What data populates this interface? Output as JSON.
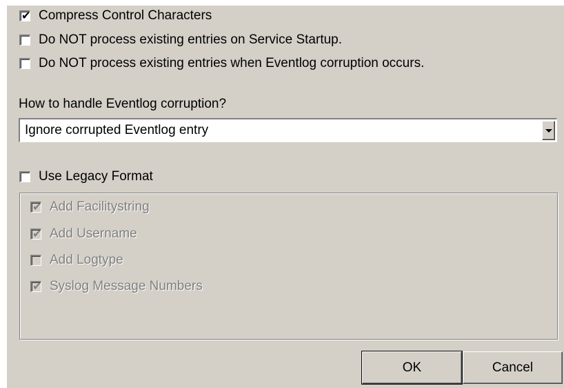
{
  "options": {
    "compress": {
      "label": "Compress Control Characters",
      "checked": true
    },
    "no_startup": {
      "label": "Do NOT process existing entries on Service Startup.",
      "checked": false
    },
    "no_corruption": {
      "label": "Do NOT process existing entries when Eventlog corruption occurs.",
      "checked": false
    }
  },
  "corruption": {
    "label": "How to handle Eventlog corruption?",
    "selected": "Ignore corrupted Eventlog entry"
  },
  "legacy": {
    "label": "Use Legacy Format",
    "checked": false
  },
  "legacy_options": {
    "facility": {
      "label": "Add Facilitystring",
      "checked": true
    },
    "username": {
      "label": "Add Username",
      "checked": true
    },
    "logtype": {
      "label": "Add Logtype",
      "checked": false
    },
    "msgnumbers": {
      "label": "Syslog Message Numbers",
      "checked": true
    }
  },
  "buttons": {
    "ok": "OK",
    "cancel": "Cancel"
  },
  "icons": {
    "check": "check-mark-icon",
    "dropdown": "chevron-down-icon"
  },
  "colors": {
    "face": "#d4d0c8",
    "shadow": "#808080"
  }
}
